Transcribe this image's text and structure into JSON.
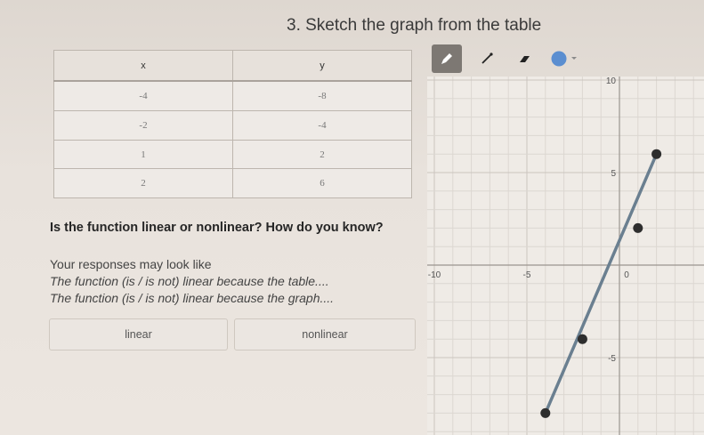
{
  "title": "3. Sketch the graph from the table",
  "table": {
    "headers": [
      "x",
      "y"
    ],
    "rows": [
      [
        "-4",
        "-8"
      ],
      [
        "-2",
        "-4"
      ],
      [
        "1",
        "2"
      ],
      [
        "2",
        "6"
      ]
    ]
  },
  "question": {
    "text": "Is the function linear or nonlinear? How do you know?",
    "hint_line": "Your responses may look like",
    "example_1": "The function (is / is not) linear because the table....",
    "example_2": "The function (is / is not) linear because the graph...."
  },
  "choices": {
    "linear": "linear",
    "nonlinear": "nonlinear"
  },
  "toolbar": {
    "tools": [
      "pencil-icon",
      "line-icon",
      "eraser-icon",
      "color-picker-icon"
    ],
    "active_tool": "pencil-icon",
    "selected_color": "#5b8ed0"
  },
  "graph": {
    "xlim": [
      -10,
      10
    ],
    "ylim": [
      -10,
      10
    ],
    "grid": true,
    "tick_labels": {
      "x": [
        "-10",
        "-5",
        "0"
      ],
      "y": [
        "10",
        "5",
        "-5"
      ]
    },
    "points": [
      [
        -4,
        -8
      ],
      [
        -2,
        -4
      ],
      [
        1,
        2
      ],
      [
        2,
        6
      ]
    ],
    "line_color": "#6a7f90",
    "point_color": "#2e2e2e"
  }
}
